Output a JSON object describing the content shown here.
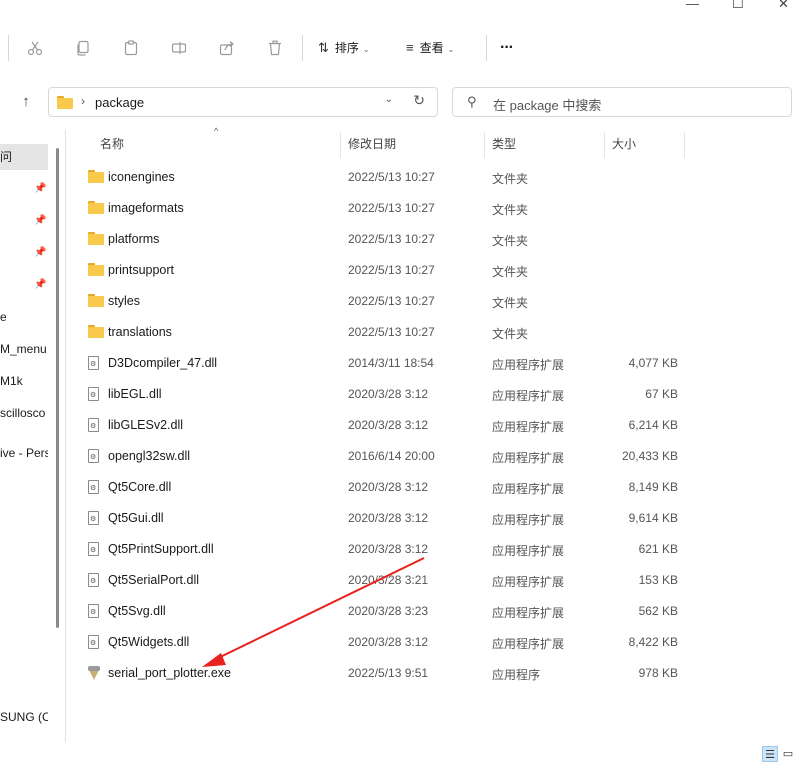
{
  "window": {
    "minimize": "—",
    "maximize": "☐",
    "close": "✕"
  },
  "toolbar": {
    "icons": [
      "scissors-icon",
      "copy-icon",
      "paste-icon",
      "rename-icon",
      "share-icon",
      "delete-icon"
    ],
    "sort_label": "排序",
    "view_label": "查看",
    "more_label": "···"
  },
  "address": {
    "path": "package",
    "search_placeholder": "在 package 中搜索"
  },
  "nav": {
    "items": [
      "问",
      "",
      "",
      "",
      "",
      "e",
      "M_menu",
      "M1k",
      "scillosco",
      "ive - Pers",
      "SUNG (C:"
    ]
  },
  "columns": {
    "name": "名称",
    "date": "修改日期",
    "type": "类型",
    "size": "大小"
  },
  "files": [
    {
      "kind": "folder",
      "name": "iconengines",
      "date": "2022/5/13 10:27",
      "type": "文件夹",
      "size": ""
    },
    {
      "kind": "folder",
      "name": "imageformats",
      "date": "2022/5/13 10:27",
      "type": "文件夹",
      "size": ""
    },
    {
      "kind": "folder",
      "name": "platforms",
      "date": "2022/5/13 10:27",
      "type": "文件夹",
      "size": ""
    },
    {
      "kind": "folder",
      "name": "printsupport",
      "date": "2022/5/13 10:27",
      "type": "文件夹",
      "size": ""
    },
    {
      "kind": "folder",
      "name": "styles",
      "date": "2022/5/13 10:27",
      "type": "文件夹",
      "size": ""
    },
    {
      "kind": "folder",
      "name": "translations",
      "date": "2022/5/13 10:27",
      "type": "文件夹",
      "size": ""
    },
    {
      "kind": "dll",
      "name": "D3Dcompiler_47.dll",
      "date": "2014/3/11 18:54",
      "type": "应用程序扩展",
      "size": "4,077 KB"
    },
    {
      "kind": "dll",
      "name": "libEGL.dll",
      "date": "2020/3/28 3:12",
      "type": "应用程序扩展",
      "size": "67 KB"
    },
    {
      "kind": "dll",
      "name": "libGLESv2.dll",
      "date": "2020/3/28 3:12",
      "type": "应用程序扩展",
      "size": "6,214 KB"
    },
    {
      "kind": "dll",
      "name": "opengl32sw.dll",
      "date": "2016/6/14 20:00",
      "type": "应用程序扩展",
      "size": "20,433 KB"
    },
    {
      "kind": "dll",
      "name": "Qt5Core.dll",
      "date": "2020/3/28 3:12",
      "type": "应用程序扩展",
      "size": "8,149 KB"
    },
    {
      "kind": "dll",
      "name": "Qt5Gui.dll",
      "date": "2020/3/28 3:12",
      "type": "应用程序扩展",
      "size": "9,614 KB"
    },
    {
      "kind": "dll",
      "name": "Qt5PrintSupport.dll",
      "date": "2020/3/28 3:12",
      "type": "应用程序扩展",
      "size": "621 KB"
    },
    {
      "kind": "dll",
      "name": "Qt5SerialPort.dll",
      "date": "2020/3/28 3:21",
      "type": "应用程序扩展",
      "size": "153 KB"
    },
    {
      "kind": "dll",
      "name": "Qt5Svg.dll",
      "date": "2020/3/28 3:23",
      "type": "应用程序扩展",
      "size": "562 KB"
    },
    {
      "kind": "dll",
      "name": "Qt5Widgets.dll",
      "date": "2020/3/28 3:12",
      "type": "应用程序扩展",
      "size": "8,422 KB"
    },
    {
      "kind": "exe",
      "name": "serial_port_plotter.exe",
      "date": "2022/5/13 9:51",
      "type": "应用程序",
      "size": "978 KB"
    }
  ],
  "annotation": {
    "arrow_color": "#e8221c"
  }
}
